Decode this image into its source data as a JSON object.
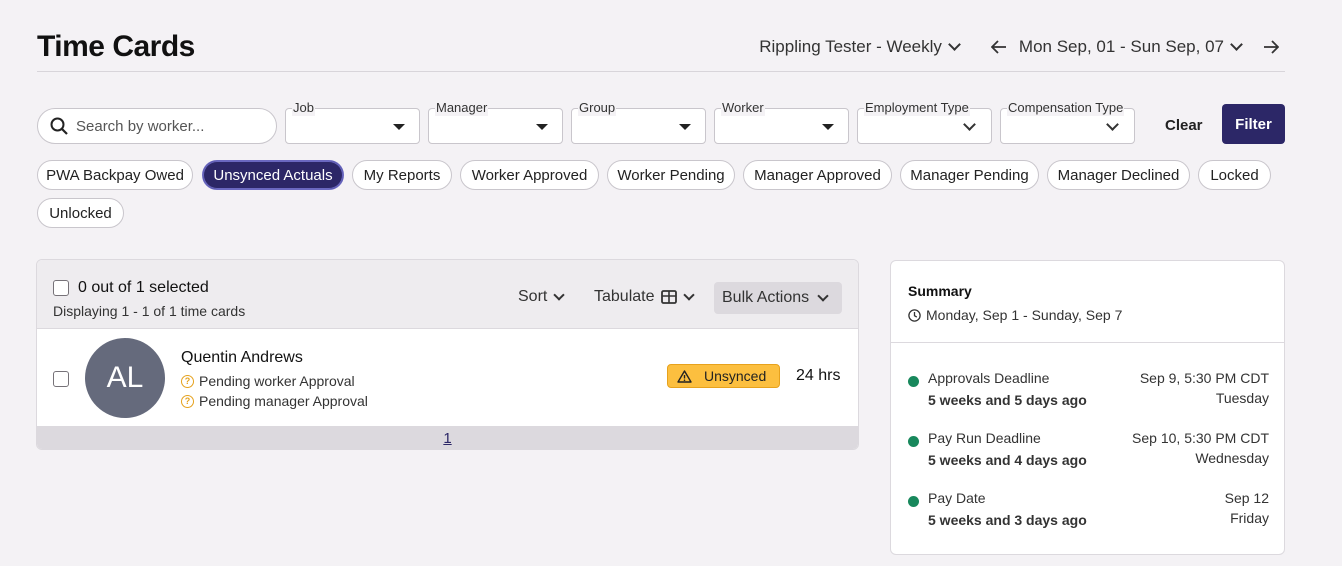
{
  "header": {
    "title": "Time Cards",
    "schedule": "Rippling Tester - Weekly",
    "date_range": "Mon Sep, 01 - Sun Sep, 07"
  },
  "filters": {
    "search_placeholder": "Search by worker...",
    "job_label": "Job",
    "manager_label": "Manager",
    "group_label": "Group",
    "worker_label": "Worker",
    "employment_type_label": "Employment Type",
    "compensation_type_label": "Compensation Type",
    "clear_label": "Clear",
    "filter_label": "Filter"
  },
  "chips": [
    {
      "label": "PWA Backpay Owed",
      "active": false
    },
    {
      "label": "Unsynced Actuals",
      "active": true
    },
    {
      "label": "My Reports",
      "active": false
    },
    {
      "label": "Worker Approved",
      "active": false
    },
    {
      "label": "Worker Pending",
      "active": false
    },
    {
      "label": "Manager Approved",
      "active": false
    },
    {
      "label": "Manager Pending",
      "active": false
    },
    {
      "label": "Manager Declined",
      "active": false
    },
    {
      "label": "Locked",
      "active": false
    },
    {
      "label": "Unlocked",
      "active": false
    }
  ],
  "list": {
    "selection_text": "0 out of 1 selected",
    "displaying_text": "Displaying 1 - 1 of 1 time cards",
    "sort_label": "Sort",
    "tabulate_label": "Tabulate",
    "bulk_actions_label": "Bulk Actions",
    "rows": [
      {
        "initials": "AL",
        "name": "Quentin Andrews",
        "status_1": "Pending worker Approval",
        "status_2": "Pending manager Approval",
        "badge": "Unsynced",
        "hours": "24 hrs"
      }
    ],
    "page": "1"
  },
  "summary": {
    "title": "Summary",
    "range": "Monday, Sep 1 - Sunday, Sep 7",
    "deadlines": [
      {
        "label": "Approvals Deadline",
        "relative": "5 weeks and 5 days ago",
        "date": "Sep 9, 5:30 PM CDT",
        "day": "Tuesday"
      },
      {
        "label": "Pay Run Deadline",
        "relative": "5 weeks and 4 days ago",
        "date": "Sep 10, 5:30 PM CDT",
        "day": "Wednesday"
      },
      {
        "label": "Pay Date",
        "relative": "5 weeks and 3 days ago",
        "date": "Sep 12",
        "day": "Friday"
      }
    ]
  },
  "colors": {
    "primary": "#2c2767",
    "background": "#f4f2f5",
    "warning": "#fcbf3f",
    "success_dot": "#18885c",
    "avatar": "#656a7c"
  }
}
